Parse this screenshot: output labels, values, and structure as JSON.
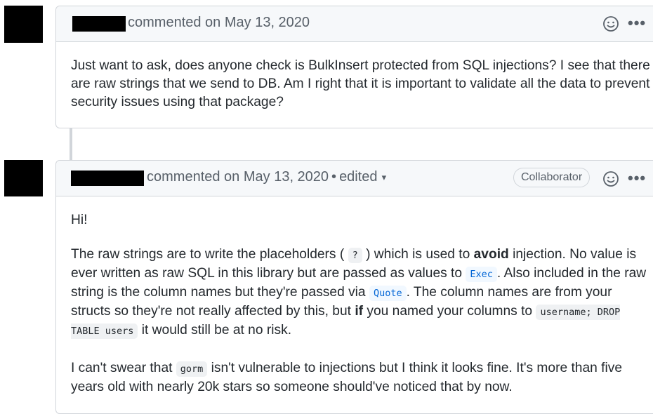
{
  "comments": [
    {
      "author_redacted": true,
      "meta": "commented on May 13, 2020",
      "body": "Just want to ask, does anyone check is BulkInsert protected from SQL injections? I see that there are raw strings that we send to DB. Am I right that it is important to validate all the data to prevent security issues using that package?"
    },
    {
      "author_redacted": true,
      "meta": "commented on May 13, 2020",
      "edited_label": "edited",
      "separator": "•",
      "badge": "Collaborator",
      "greeting": "Hi!",
      "p1": {
        "t1": "The raw strings are to write the placeholders ( ",
        "c1": "?",
        "t2": " ) which is used to ",
        "b1": "avoid",
        "t3": " injection. No value is ever written as raw SQL in this library but are passed as values to ",
        "c2": "Exec",
        "t4": ". Also included in the raw string is the column names but they're passed via ",
        "c3": "Quote",
        "t5": ". The column names are from your structs so they're not really affected by this, but ",
        "b2": "if",
        "t6": " you named your columns to ",
        "c4": "username; DROP TABLE users",
        "t7": " it would still be at no risk."
      },
      "p2": {
        "t1": "I can't swear that ",
        "c1": "gorm",
        "t2": " isn't vulnerable to injections but I think it looks fine. It's more than five years old with nearly 20k stars so someone should've noticed that by now."
      }
    }
  ],
  "icons": {
    "reaction": "smiley-icon",
    "more": "kebab-icon",
    "dots": "•••",
    "caret": "▾"
  }
}
